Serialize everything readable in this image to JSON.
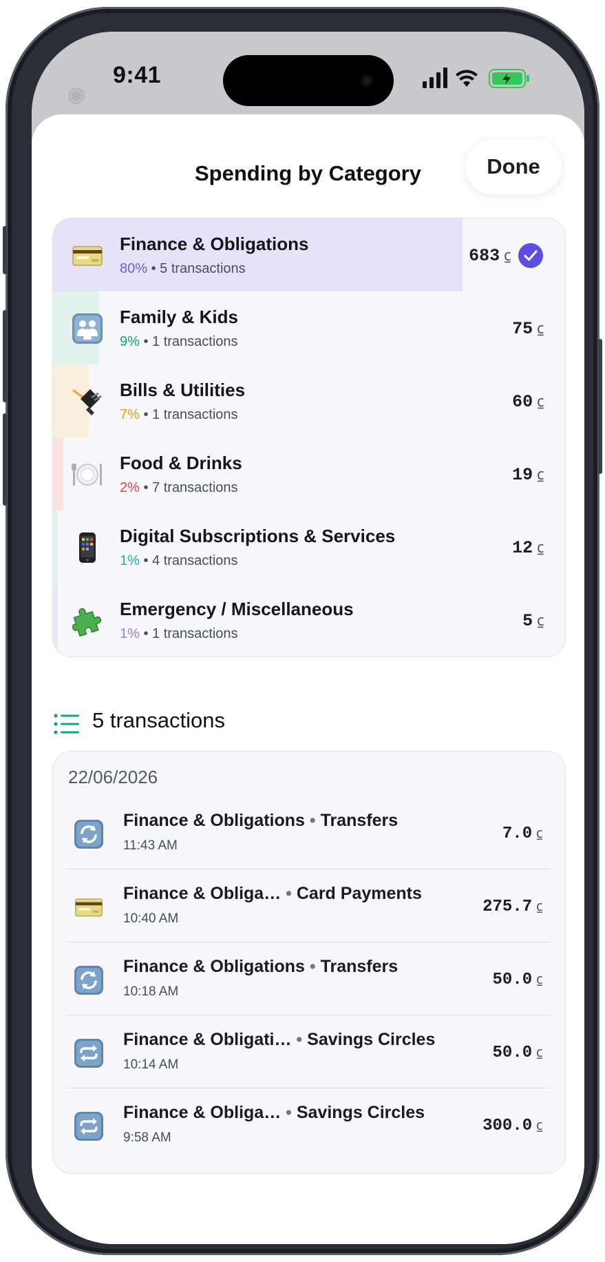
{
  "status_bar": {
    "time": "9:41"
  },
  "sheet": {
    "title": "Spending by Category",
    "done_label": "Done"
  },
  "currency_symbol": "⃀",
  "categories": [
    {
      "name": "Finance & Obligations",
      "percent": "80%",
      "percent_value": 0.8,
      "count": "5 transactions",
      "amount": "683",
      "icon": "credit-card-icon",
      "color": "#6d5ce7",
      "bar_color": "#e6e3f8",
      "selected": true
    },
    {
      "name": "Family & Kids",
      "percent": "9%",
      "percent_value": 0.09,
      "count": "1 transactions",
      "amount": "75",
      "icon": "family-icon",
      "color": "#12a47c",
      "bar_color": "#e1f3ec",
      "selected": false
    },
    {
      "name": "Bills & Utilities",
      "percent": "7%",
      "percent_value": 0.07,
      "count": "1 transactions",
      "amount": "60",
      "icon": "electric-plug-icon",
      "color": "#e0a21a",
      "bar_color": "#faefdc",
      "selected": false
    },
    {
      "name": "Food & Drinks",
      "percent": "2%",
      "percent_value": 0.02,
      "count": "7 transactions",
      "amount": "19",
      "icon": "plate-cutlery-icon",
      "color": "#e5434b",
      "bar_color": "#fbe3e4",
      "selected": false
    },
    {
      "name": "Digital Subscriptions & Services",
      "percent": "1%",
      "percent_value": 0.01,
      "count": "4 transactions",
      "amount": "12",
      "icon": "mobile-phone-icon",
      "color": "#17aebd",
      "bar_color": "#dff3f3",
      "selected": false
    },
    {
      "name": "Emergency / Miscellaneous",
      "percent": "1%",
      "percent_value": 0.01,
      "count": "1 transactions",
      "amount": "5",
      "icon": "puzzle-piece-icon",
      "color": "#9c7fe0",
      "bar_color": "#ece6f8",
      "selected": false
    }
  ],
  "transactions_header": "5 transactions",
  "transactions": {
    "date": "22/06/2026",
    "items": [
      {
        "category": "Finance & Obligations",
        "separator": " • ",
        "subcategory": "Transfers",
        "time": "11:43 AM",
        "amount": "7.0",
        "icon": "refresh-icon"
      },
      {
        "category": "Finance & Obliga…",
        "separator": " • ",
        "subcategory": "Card Payments",
        "time": "10:40 AM",
        "amount": "275.7",
        "icon": "credit-card-icon"
      },
      {
        "category": "Finance & Obligations",
        "separator": " • ",
        "subcategory": "Transfers",
        "time": "10:18 AM",
        "amount": "50.0",
        "icon": "refresh-icon"
      },
      {
        "category": "Finance & Obligati…",
        "separator": " • ",
        "subcategory": "Savings Circles",
        "time": "10:14 AM",
        "amount": "50.0",
        "icon": "repeat-icon"
      },
      {
        "category": "Finance & Obliga…",
        "separator": " • ",
        "subcategory": "Savings Circles",
        "time": "9:58 AM",
        "amount": "300.0",
        "icon": "repeat-icon"
      }
    ]
  }
}
